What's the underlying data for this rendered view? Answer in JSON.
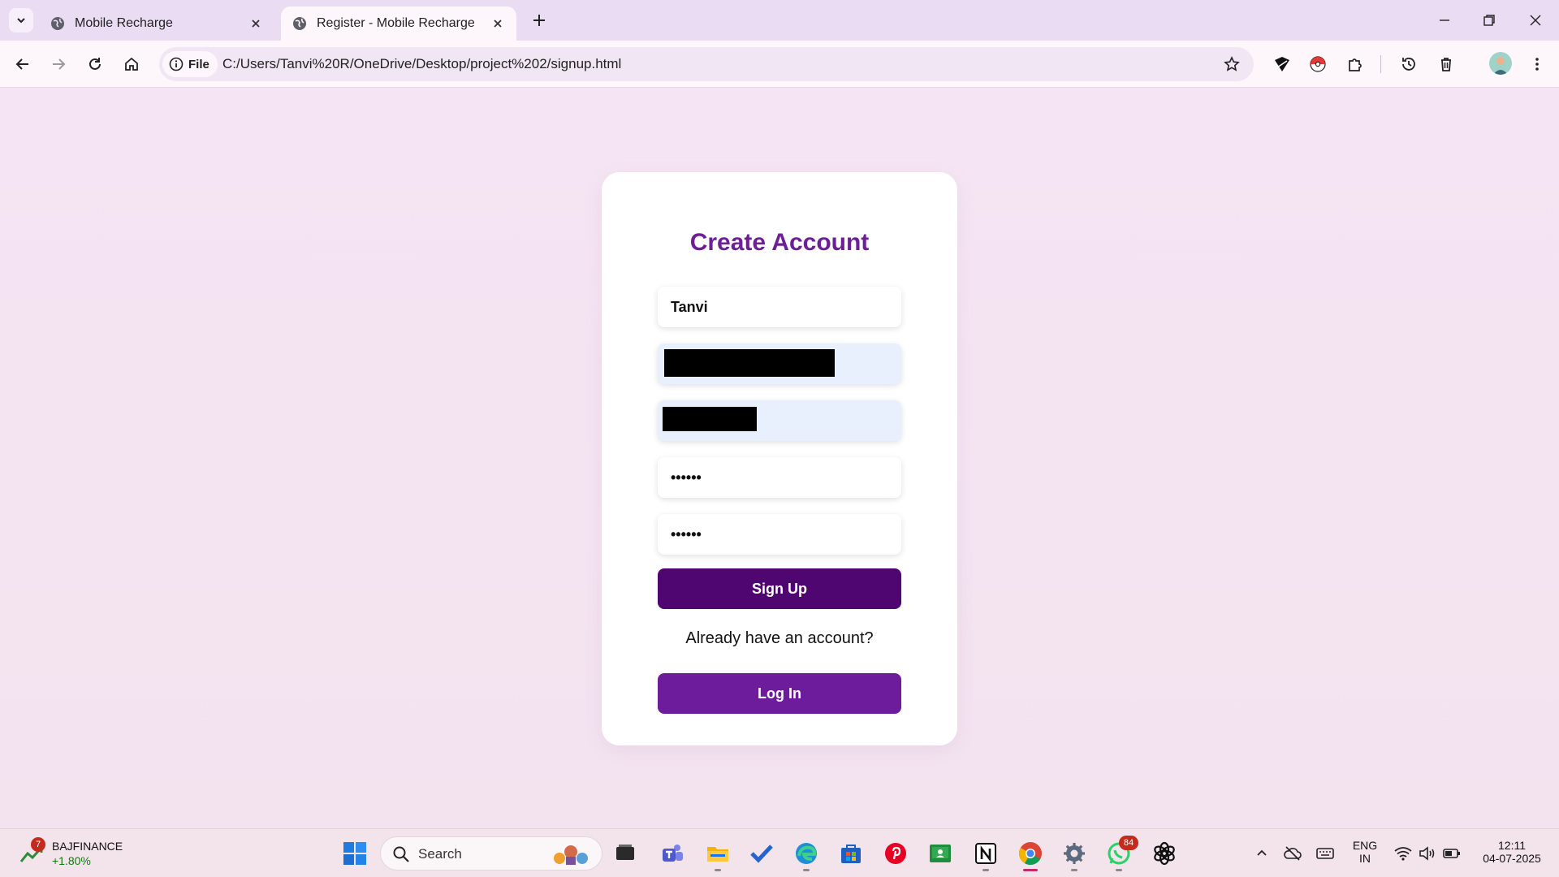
{
  "browser": {
    "tabs": [
      {
        "label": "Mobile Recharge",
        "active": false
      },
      {
        "label": "Register - Mobile Recharge",
        "active": true
      }
    ],
    "omnibox": {
      "chip_label": "File",
      "url": "C:/Users/Tanvi%20R/OneDrive/Desktop/project%202/signup.html"
    }
  },
  "signup_card": {
    "title": "Create Account",
    "name_value": "Tanvi",
    "password_value": "••••••",
    "confirm_password_value": "••••••",
    "signup_label": "Sign Up",
    "already_text": "Already have an account?",
    "login_label": "Log In"
  },
  "taskbar": {
    "stock_name": "BAJFINANCE",
    "stock_change": "+1.80%",
    "stock_badge": "7",
    "search_label": "Search",
    "whatsapp_badge": "84",
    "language_line1": "ENG",
    "language_line2": "IN",
    "time": "12:11",
    "date": "04-07-2025"
  },
  "colors": {
    "accent_purple": "#6e1f96",
    "signup_button": "#4f0670",
    "login_button": "#6d1c9b",
    "page_background": "#f4e4f1"
  }
}
